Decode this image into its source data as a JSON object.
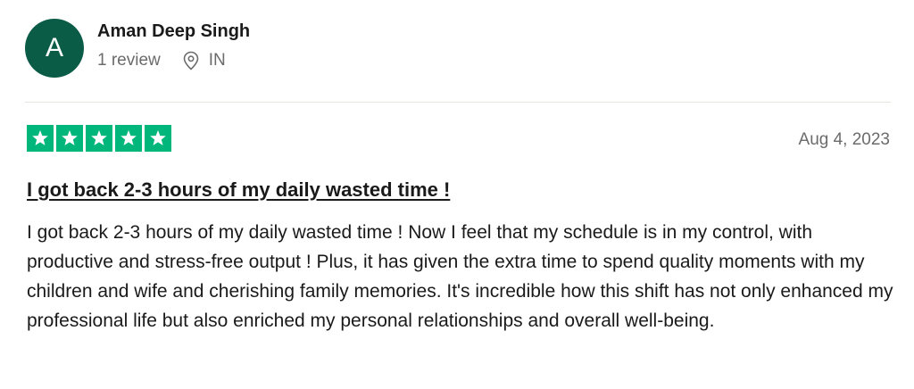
{
  "reviewer": {
    "avatar_letter": "A",
    "avatar_color": "#0b5c47",
    "name": "Aman Deep Singh",
    "review_count": "1 review",
    "location": "IN"
  },
  "review": {
    "rating": 5,
    "rating_max": 5,
    "star_color": "#00b67a",
    "date": "Aug 4, 2023",
    "title": "I got back 2-3 hours of my daily wasted time !",
    "body": "I got back 2-3 hours of my daily wasted time ! Now I feel that my schedule is in my control, with productive and stress-free output ! Plus, it has given the extra time to spend quality moments with my children and wife and cherishing family memories. It's incredible how this shift has not only enhanced my professional life but also enriched my personal relationships and overall well-being."
  },
  "icons": {
    "location": "map-pin-icon",
    "star": "star-icon"
  }
}
